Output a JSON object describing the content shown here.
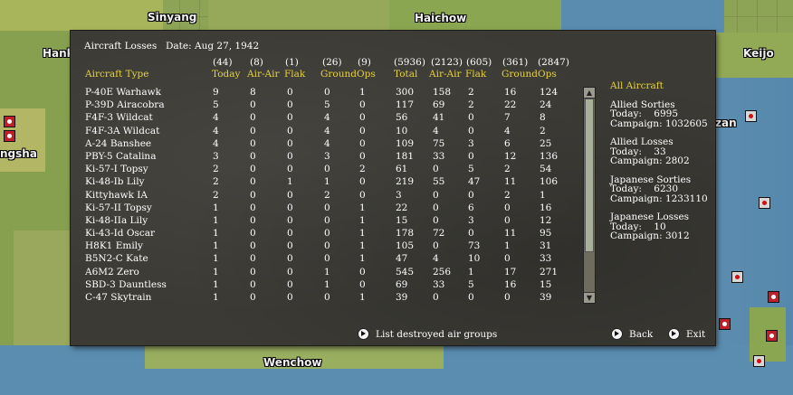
{
  "map": {
    "cities": [
      "Sinyang",
      "Haichow",
      "Hank",
      "Keijo",
      "ngsha",
      "zan",
      "Wenchow"
    ]
  },
  "dialog": {
    "title": "Aircraft Losses",
    "date": "Date: Aug 27, 1942",
    "column_counts": [
      "(44)",
      "(8)",
      "(1)",
      "(26)",
      "(9)",
      "(5936)",
      "(2123)",
      "(605)",
      "(361)",
      "(2847)"
    ],
    "column_labels": [
      "Aircraft Type",
      "Today",
      "Air-Air",
      "Flak",
      "Ground",
      "Ops",
      "Total",
      "Air-Air",
      "Flak",
      "Ground",
      "Ops"
    ],
    "rows": [
      [
        "P-40E Warhawk",
        "9",
        "8",
        "0",
        "0",
        "1",
        "300",
        "158",
        "2",
        "16",
        "124"
      ],
      [
        "P-39D Airacobra",
        "5",
        "0",
        "0",
        "5",
        "0",
        "117",
        "69",
        "2",
        "22",
        "24"
      ],
      [
        "F4F-3 Wildcat",
        "4",
        "0",
        "0",
        "4",
        "0",
        "56",
        "41",
        "0",
        "7",
        "8"
      ],
      [
        "F4F-3A Wildcat",
        "4",
        "0",
        "0",
        "4",
        "0",
        "10",
        "4",
        "0",
        "4",
        "2"
      ],
      [
        "A-24 Banshee",
        "4",
        "0",
        "0",
        "4",
        "0",
        "109",
        "75",
        "3",
        "6",
        "25"
      ],
      [
        "PBY-5 Catalina",
        "3",
        "0",
        "0",
        "3",
        "0",
        "181",
        "33",
        "0",
        "12",
        "136"
      ],
      [
        "Ki-57-I Topsy",
        "2",
        "0",
        "0",
        "0",
        "2",
        "61",
        "0",
        "5",
        "2",
        "54"
      ],
      [
        "Ki-48-Ib Lily",
        "2",
        "0",
        "1",
        "1",
        "0",
        "219",
        "55",
        "47",
        "11",
        "106"
      ],
      [
        "Kittyhawk IA",
        "2",
        "0",
        "0",
        "2",
        "0",
        "3",
        "0",
        "0",
        "2",
        "1"
      ],
      [
        "Ki-57-II Topsy",
        "1",
        "0",
        "0",
        "0",
        "1",
        "22",
        "0",
        "6",
        "0",
        "16"
      ],
      [
        "Ki-48-IIa Lily",
        "1",
        "0",
        "0",
        "0",
        "1",
        "15",
        "0",
        "3",
        "0",
        "12"
      ],
      [
        "Ki-43-Id Oscar",
        "1",
        "0",
        "0",
        "0",
        "1",
        "178",
        "72",
        "0",
        "11",
        "95"
      ],
      [
        "H8K1 Emily",
        "1",
        "0",
        "0",
        "0",
        "1",
        "105",
        "0",
        "73",
        "1",
        "31"
      ],
      [
        "B5N2-C Kate",
        "1",
        "0",
        "0",
        "0",
        "1",
        "47",
        "4",
        "10",
        "0",
        "33"
      ],
      [
        "A6M2 Zero",
        "1",
        "0",
        "0",
        "1",
        "0",
        "545",
        "256",
        "1",
        "17",
        "271"
      ],
      [
        "SBD-3 Dauntless",
        "1",
        "0",
        "0",
        "1",
        "0",
        "69",
        "33",
        "5",
        "16",
        "15"
      ],
      [
        "C-47 Skytrain",
        "1",
        "0",
        "0",
        "0",
        "1",
        "39",
        "0",
        "0",
        "0",
        "39"
      ]
    ],
    "summary": {
      "title": "All Aircraft",
      "allied_sorties": {
        "label": "Allied Sorties",
        "today": "Today:    6995",
        "campaign": "Campaign: 1032605"
      },
      "allied_losses": {
        "label": "Allied Losses",
        "today": "Today:    33",
        "campaign": "Campaign: 2802"
      },
      "japanese_sorties": {
        "label": "Japanese Sorties",
        "today": "Today:    6230",
        "campaign": "Campaign: 1233110"
      },
      "japanese_losses": {
        "label": "Japanese Losses",
        "today": "Today:    10",
        "campaign": "Campaign: 3012"
      }
    },
    "buttons": {
      "list_destroyed": "List destroyed air groups",
      "back": "Back",
      "exit": "Exit"
    },
    "icons": {
      "button_arrow": "arrow-right-circle-icon",
      "scroll_up": "scroll-up-arrow-icon",
      "scroll_down": "scroll-down-arrow-icon",
      "map_marker": "base-marker-icon"
    },
    "colors": {
      "header_label": "#e7d23a",
      "panel": "#3b3a35",
      "text": "#ffffff"
    }
  }
}
